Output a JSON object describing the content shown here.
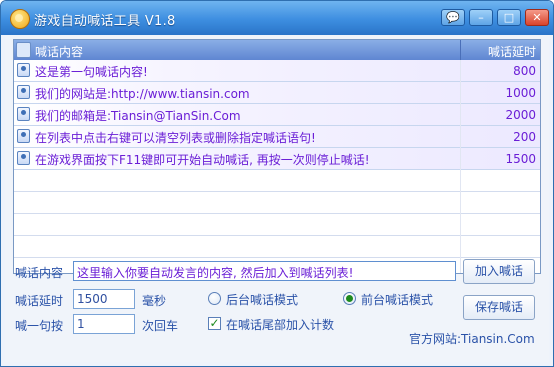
{
  "window": {
    "title": "游戏自动喊话工具 V1.8",
    "controls": {
      "skin": "💬",
      "minimize": "–",
      "maximize": "□",
      "close": "✕"
    }
  },
  "list": {
    "headers": {
      "content": "喊话内容",
      "delay": "喊话延时"
    },
    "rows": [
      {
        "text": "这是第一句喊话内容!",
        "delay": "800"
      },
      {
        "text": "我们的网站是:http://www.tiansin.com",
        "delay": "1000"
      },
      {
        "text": "我们的邮箱是:Tiansin@TianSin.Com",
        "delay": "2000"
      },
      {
        "text": "在列表中点击右键可以清空列表或删除指定喊话语句!",
        "delay": "200"
      },
      {
        "text": "在游戏界面按下F11键即可开始自动喊话, 再按一次则停止喊话!",
        "delay": "1500"
      }
    ]
  },
  "form": {
    "message_label": "喊话内容",
    "message_value": "这里输入你要自动发言的内容, 然后加入到喊话列表!",
    "delay_label": "喊话延时",
    "delay_value": "1500",
    "delay_unit": "毫秒",
    "enter_label": "喊一句按",
    "enter_value": "1",
    "enter_unit": "次回车",
    "mode_background": "后台喊话模式",
    "mode_foreground": "前台喊话模式",
    "selected_mode": "foreground",
    "append_count_label": "在喊话尾部加入计数",
    "append_count_checked": true
  },
  "buttons": {
    "add": "加入喊话",
    "save": "保存喊话"
  },
  "footer": {
    "site": "官方网站:Tiansin.Com"
  },
  "colors": {
    "title_bar": "#3d8ee0",
    "accent_text": "#6a1ed6",
    "label_text": "#2a52a8",
    "radio_dot": "#1e8a1e"
  }
}
